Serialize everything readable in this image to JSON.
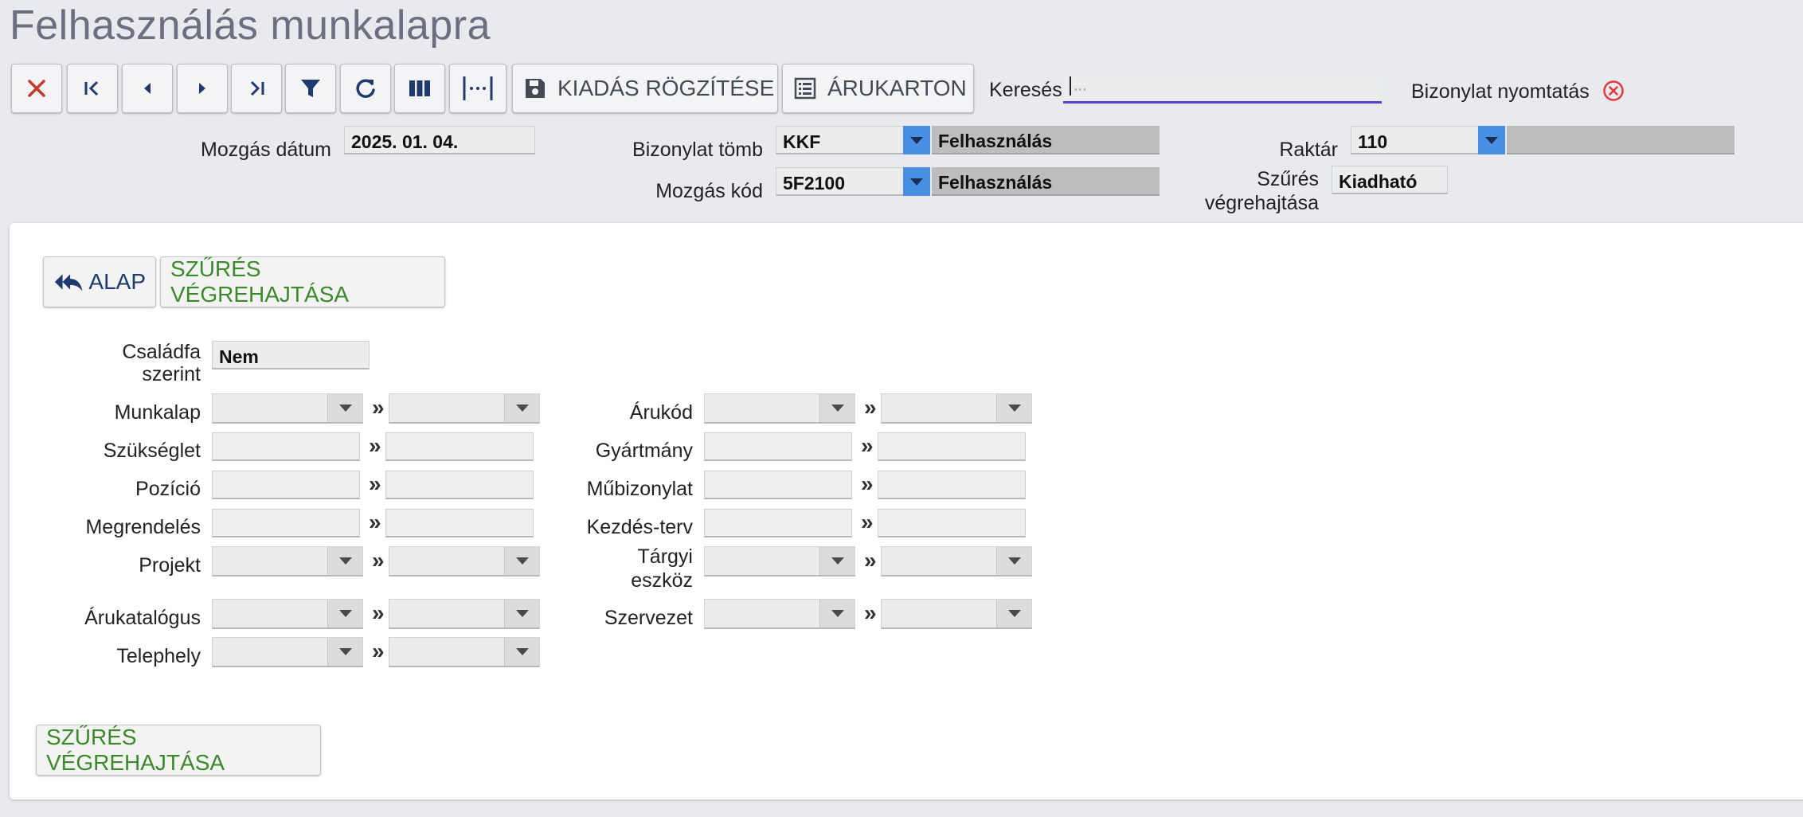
{
  "page": {
    "title": "Felhasználás munkalapra"
  },
  "toolbar": {
    "kiadas_label": "KIADÁS RÖGZÍTÉSE",
    "arukarton_label": "ÁRUKARTON",
    "search_label": "Keresés:",
    "search_placeholder": "...",
    "print_label": "Bizonylat nyomtatás"
  },
  "header": {
    "mozgas_datum_label": "Mozgás dátum",
    "mozgas_datum_value": "2025. 01. 04.",
    "bizonylat_tomb_label": "Bizonylat tömb",
    "bizonylat_tomb_value": "KKF",
    "bizonylat_tomb_desc": "Felhasználás",
    "mozgas_kod_label": "Mozgás kód",
    "mozgas_kod_value": "5F2100",
    "mozgas_kod_desc": "Felhasználás",
    "raktar_label": "Raktár",
    "raktar_value": "110",
    "szures_label_1": "Szűrés",
    "szures_label_2": "végrehajtása",
    "szures_value": "Kiadható"
  },
  "panel": {
    "alap_label": "ALAP",
    "szures_btn_label": "SZŰRÉS VÉGREHAJTÁSA",
    "csaladfa_label_1": "Családfa",
    "csaladfa_label_2": "szerint",
    "csaladfa_value": "Nem",
    "sep": "»",
    "left_labels": {
      "munkalap": "Munkalap",
      "szukseglet": "Szükséglet",
      "pozicio": "Pozíció",
      "megrendeles": "Megrendelés",
      "projekt": "Projekt",
      "arukatalogus": "Árukatalógus",
      "telephely": "Telephely"
    },
    "right_labels": {
      "arukod": "Árukód",
      "gyartmany": "Gyártmány",
      "mubizonylat": "Műbizonylat",
      "kezdes_terv": "Kezdés-terv",
      "targyi_1": "Tárgyi",
      "targyi_2": "eszköz",
      "szervezet": "Szervezet"
    },
    "bottom_btn_label": "SZŰRÉS VÉGREHAJTÁSA"
  },
  "colors": {
    "accent_green": "#3b8a2a",
    "navy": "#1f3a6e",
    "dropdown_blue": "#4a90e2",
    "clear_red": "#e0393e"
  }
}
